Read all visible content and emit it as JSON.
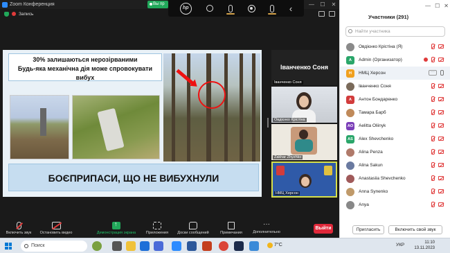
{
  "window": {
    "title": "Zoom Конференция",
    "sharing_pill": "Вы пр",
    "controls": [
      "—",
      "☐",
      "✕"
    ]
  },
  "recording": {
    "label": "Запись"
  },
  "hp_toolbar": {
    "logo": "hp"
  },
  "slide": {
    "line1": "30% залишаються нерозірваними",
    "line2": "Будь-яка механічна дія може спровокувати вибух",
    "banner": "БОЄПРИПАСИ, ЩО НЕ ВИБУХНУЛИ"
  },
  "gallery": {
    "active_speaker": "Іванченко Соня",
    "tiles": [
      {
        "label": "Іванченко Соня"
      },
      {
        "label": "Овдієнко Крістіна"
      },
      {
        "label": "Zakhar Zhyzhko"
      },
      {
        "label": "НМЦ Херсон"
      }
    ]
  },
  "zoom_toolbar": {
    "items": [
      {
        "label": "Включить звук"
      },
      {
        "label": "Остановить видео"
      },
      {
        "label": "Демонстрация экрана"
      },
      {
        "label": "Приложения"
      },
      {
        "label": "Доски сообщений"
      },
      {
        "label": "Примечания"
      },
      {
        "label": "Дополнительно"
      }
    ],
    "end_label": "Выйти"
  },
  "participants": {
    "title": "Участники (291)",
    "search_placeholder": "Найти участника",
    "list": [
      {
        "initials": "",
        "name": "Овдієнко Крістіна (Я)",
        "color": "#8a8a8a",
        "photo": true
      },
      {
        "initials": "A",
        "name": "Admin (Организатор)",
        "color": "#2aa66a"
      },
      {
        "initials": "Н",
        "name": "НМЦ Херсон",
        "color": "#f0a01e"
      },
      {
        "initials": "",
        "name": "Іванченко Соня",
        "color": "#7a6a5a",
        "photo": true
      },
      {
        "initials": "A",
        "name": "Антон Бондаренко",
        "color": "#d23c3c"
      },
      {
        "initials": "",
        "name": "Тамара Барб",
        "color": "#c08a5a",
        "photo": true
      },
      {
        "initials": "AO",
        "name": "Aelitta Oliinyk",
        "color": "#7b3fb8"
      },
      {
        "initials": "AS",
        "name": "Alex Shevchenko",
        "color": "#2aa66a"
      },
      {
        "initials": "",
        "name": "Alina Penza",
        "color": "#b07a6a",
        "photo": true
      },
      {
        "initials": "",
        "name": "Alina Sakun",
        "color": "#6a7aa0",
        "photo": true
      },
      {
        "initials": "",
        "name": "Anastasiia Shevchenko",
        "color": "#a05a5a",
        "photo": true
      },
      {
        "initials": "",
        "name": "Anna Synenko",
        "color": "#c09a6a",
        "photo": true
      },
      {
        "initials": "",
        "name": "Anya",
        "color": "#888",
        "photo": true
      }
    ],
    "invite_label": "Пригласить",
    "unmute_label": "Включить свой звук"
  },
  "taskbar": {
    "search_label": "Поиск",
    "weather": "7°C",
    "language": "УКР",
    "time": "11:10",
    "date": "13.11.2023"
  }
}
